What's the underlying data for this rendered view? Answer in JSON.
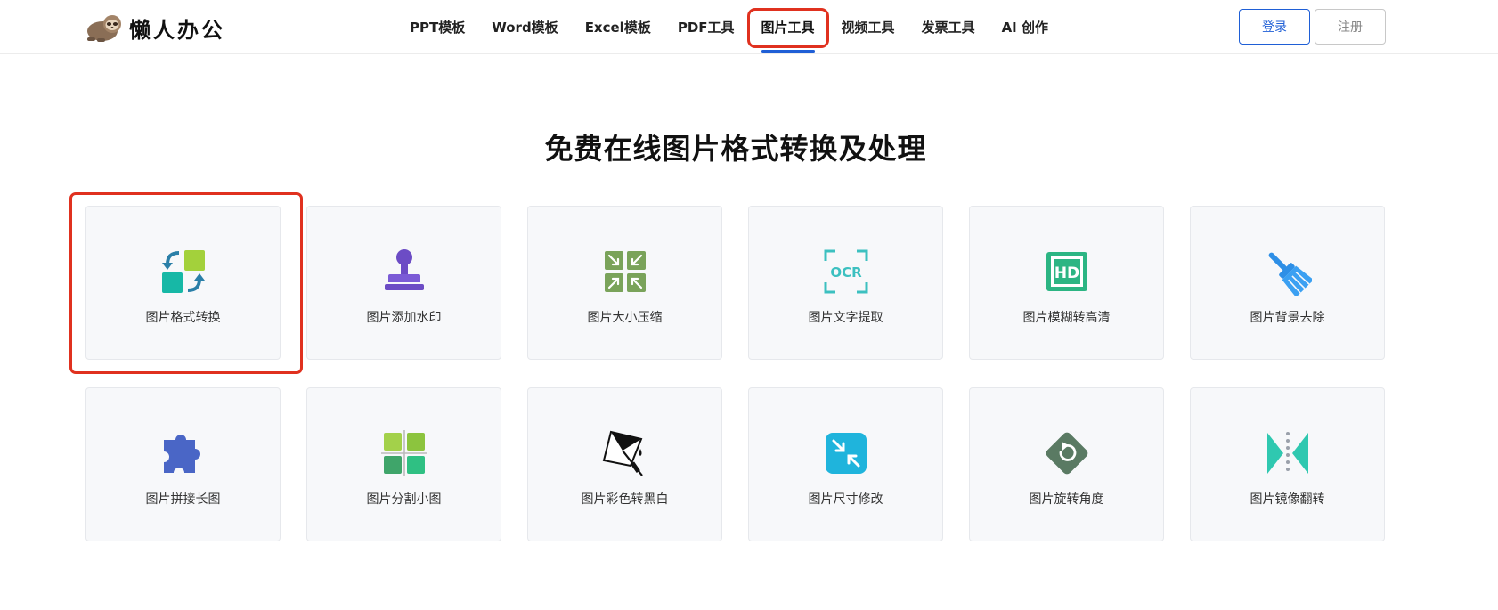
{
  "brand": {
    "name": "懒人办公",
    "logo_icon": "sloth-logo-icon"
  },
  "nav": {
    "items": [
      {
        "label": "PPT模板"
      },
      {
        "label": "Word模板"
      },
      {
        "label": "Excel模板"
      },
      {
        "label": "PDF工具"
      },
      {
        "label": "图片工具",
        "active": true
      },
      {
        "label": "视频工具"
      },
      {
        "label": "发票工具"
      },
      {
        "label": "AI 创作"
      }
    ]
  },
  "auth": {
    "login_label": "登录",
    "register_label": "注册"
  },
  "hero": {
    "title": "免费在线图片格式转换及处理"
  },
  "tools": [
    {
      "label": "图片格式转换",
      "icon": "format-convert-icon"
    },
    {
      "label": "图片添加水印",
      "icon": "stamp-watermark-icon"
    },
    {
      "label": "图片大小压缩",
      "icon": "compress-icon"
    },
    {
      "label": "图片文字提取",
      "icon": "ocr-icon"
    },
    {
      "label": "图片模糊转高清",
      "icon": "hd-icon"
    },
    {
      "label": "图片背景去除",
      "icon": "broom-icon"
    },
    {
      "label": "图片拼接长图",
      "icon": "puzzle-icon"
    },
    {
      "label": "图片分割小图",
      "icon": "split-grid-icon"
    },
    {
      "label": "图片彩色转黑白",
      "icon": "paint-bucket-icon"
    },
    {
      "label": "图片尺寸修改",
      "icon": "resize-icon"
    },
    {
      "label": "图片旋转角度",
      "icon": "rotate-icon"
    },
    {
      "label": "图片镜像翻转",
      "icon": "mirror-flip-icon"
    }
  ],
  "colors": {
    "accent": "#1f5fd6",
    "highlight": "#e0311f",
    "card_bg": "#f7f8fa"
  }
}
